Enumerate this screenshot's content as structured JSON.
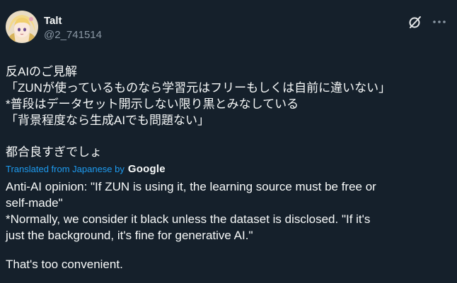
{
  "author": {
    "display_name": "Talt",
    "handle": "@2_741514",
    "avatar_icon": "anime-avatar-icon"
  },
  "actions": {
    "grok_icon": "grok-icon",
    "more_icon": "more-options-icon"
  },
  "original_text": {
    "line1": "反AIのご見解",
    "line2": "「ZUNが使っているものなら学習元はフリーもしくは自前に違いない」",
    "line3": "*普段はデータセット開示しない限り黒とみなしている",
    "line4": "「背景程度なら生成AIでも問題ない」",
    "line5": "都合良すぎでしょ"
  },
  "translation": {
    "label": "Translated from Japanese by",
    "provider": "Google",
    "line1": "Anti-AI opinion: \"If ZUN is using it, the learning source must be free or",
    "line2": "self-made\"",
    "line3": "*Normally, we consider it black unless the dataset is disclosed. \"If it's",
    "line4": "just the background, it's fine for generative AI.\"",
    "line5": "That's too convenient."
  },
  "colors": {
    "background": "#15202b",
    "text": "#f7f9f9",
    "secondary": "#8b98a5",
    "link": "#1d9bf0"
  }
}
